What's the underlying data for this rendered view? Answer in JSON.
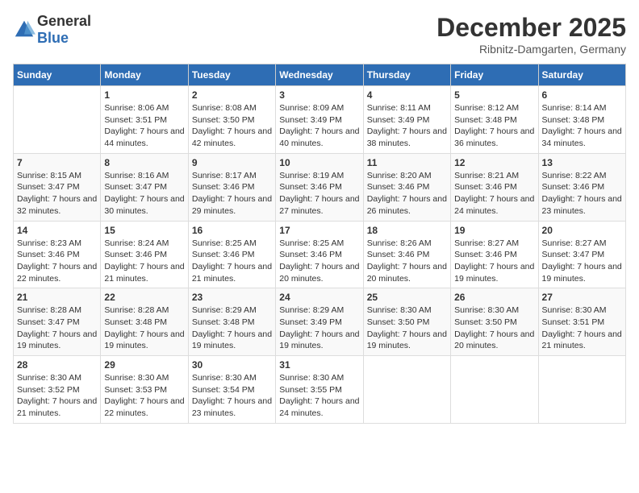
{
  "header": {
    "logo_general": "General",
    "logo_blue": "Blue",
    "month_title": "December 2025",
    "location": "Ribnitz-Damgarten, Germany"
  },
  "days_of_week": [
    "Sunday",
    "Monday",
    "Tuesday",
    "Wednesday",
    "Thursday",
    "Friday",
    "Saturday"
  ],
  "weeks": [
    [
      {
        "day": "",
        "sunrise": "",
        "sunset": "",
        "daylight": ""
      },
      {
        "day": "1",
        "sunrise": "Sunrise: 8:06 AM",
        "sunset": "Sunset: 3:51 PM",
        "daylight": "Daylight: 7 hours and 44 minutes."
      },
      {
        "day": "2",
        "sunrise": "Sunrise: 8:08 AM",
        "sunset": "Sunset: 3:50 PM",
        "daylight": "Daylight: 7 hours and 42 minutes."
      },
      {
        "day": "3",
        "sunrise": "Sunrise: 8:09 AM",
        "sunset": "Sunset: 3:49 PM",
        "daylight": "Daylight: 7 hours and 40 minutes."
      },
      {
        "day": "4",
        "sunrise": "Sunrise: 8:11 AM",
        "sunset": "Sunset: 3:49 PM",
        "daylight": "Daylight: 7 hours and 38 minutes."
      },
      {
        "day": "5",
        "sunrise": "Sunrise: 8:12 AM",
        "sunset": "Sunset: 3:48 PM",
        "daylight": "Daylight: 7 hours and 36 minutes."
      },
      {
        "day": "6",
        "sunrise": "Sunrise: 8:14 AM",
        "sunset": "Sunset: 3:48 PM",
        "daylight": "Daylight: 7 hours and 34 minutes."
      }
    ],
    [
      {
        "day": "7",
        "sunrise": "Sunrise: 8:15 AM",
        "sunset": "Sunset: 3:47 PM",
        "daylight": "Daylight: 7 hours and 32 minutes."
      },
      {
        "day": "8",
        "sunrise": "Sunrise: 8:16 AM",
        "sunset": "Sunset: 3:47 PM",
        "daylight": "Daylight: 7 hours and 30 minutes."
      },
      {
        "day": "9",
        "sunrise": "Sunrise: 8:17 AM",
        "sunset": "Sunset: 3:46 PM",
        "daylight": "Daylight: 7 hours and 29 minutes."
      },
      {
        "day": "10",
        "sunrise": "Sunrise: 8:19 AM",
        "sunset": "Sunset: 3:46 PM",
        "daylight": "Daylight: 7 hours and 27 minutes."
      },
      {
        "day": "11",
        "sunrise": "Sunrise: 8:20 AM",
        "sunset": "Sunset: 3:46 PM",
        "daylight": "Daylight: 7 hours and 26 minutes."
      },
      {
        "day": "12",
        "sunrise": "Sunrise: 8:21 AM",
        "sunset": "Sunset: 3:46 PM",
        "daylight": "Daylight: 7 hours and 24 minutes."
      },
      {
        "day": "13",
        "sunrise": "Sunrise: 8:22 AM",
        "sunset": "Sunset: 3:46 PM",
        "daylight": "Daylight: 7 hours and 23 minutes."
      }
    ],
    [
      {
        "day": "14",
        "sunrise": "Sunrise: 8:23 AM",
        "sunset": "Sunset: 3:46 PM",
        "daylight": "Daylight: 7 hours and 22 minutes."
      },
      {
        "day": "15",
        "sunrise": "Sunrise: 8:24 AM",
        "sunset": "Sunset: 3:46 PM",
        "daylight": "Daylight: 7 hours and 21 minutes."
      },
      {
        "day": "16",
        "sunrise": "Sunrise: 8:25 AM",
        "sunset": "Sunset: 3:46 PM",
        "daylight": "Daylight: 7 hours and 21 minutes."
      },
      {
        "day": "17",
        "sunrise": "Sunrise: 8:25 AM",
        "sunset": "Sunset: 3:46 PM",
        "daylight": "Daylight: 7 hours and 20 minutes."
      },
      {
        "day": "18",
        "sunrise": "Sunrise: 8:26 AM",
        "sunset": "Sunset: 3:46 PM",
        "daylight": "Daylight: 7 hours and 20 minutes."
      },
      {
        "day": "19",
        "sunrise": "Sunrise: 8:27 AM",
        "sunset": "Sunset: 3:46 PM",
        "daylight": "Daylight: 7 hours and 19 minutes."
      },
      {
        "day": "20",
        "sunrise": "Sunrise: 8:27 AM",
        "sunset": "Sunset: 3:47 PM",
        "daylight": "Daylight: 7 hours and 19 minutes."
      }
    ],
    [
      {
        "day": "21",
        "sunrise": "Sunrise: 8:28 AM",
        "sunset": "Sunset: 3:47 PM",
        "daylight": "Daylight: 7 hours and 19 minutes."
      },
      {
        "day": "22",
        "sunrise": "Sunrise: 8:28 AM",
        "sunset": "Sunset: 3:48 PM",
        "daylight": "Daylight: 7 hours and 19 minutes."
      },
      {
        "day": "23",
        "sunrise": "Sunrise: 8:29 AM",
        "sunset": "Sunset: 3:48 PM",
        "daylight": "Daylight: 7 hours and 19 minutes."
      },
      {
        "day": "24",
        "sunrise": "Sunrise: 8:29 AM",
        "sunset": "Sunset: 3:49 PM",
        "daylight": "Daylight: 7 hours and 19 minutes."
      },
      {
        "day": "25",
        "sunrise": "Sunrise: 8:30 AM",
        "sunset": "Sunset: 3:50 PM",
        "daylight": "Daylight: 7 hours and 19 minutes."
      },
      {
        "day": "26",
        "sunrise": "Sunrise: 8:30 AM",
        "sunset": "Sunset: 3:50 PM",
        "daylight": "Daylight: 7 hours and 20 minutes."
      },
      {
        "day": "27",
        "sunrise": "Sunrise: 8:30 AM",
        "sunset": "Sunset: 3:51 PM",
        "daylight": "Daylight: 7 hours and 21 minutes."
      }
    ],
    [
      {
        "day": "28",
        "sunrise": "Sunrise: 8:30 AM",
        "sunset": "Sunset: 3:52 PM",
        "daylight": "Daylight: 7 hours and 21 minutes."
      },
      {
        "day": "29",
        "sunrise": "Sunrise: 8:30 AM",
        "sunset": "Sunset: 3:53 PM",
        "daylight": "Daylight: 7 hours and 22 minutes."
      },
      {
        "day": "30",
        "sunrise": "Sunrise: 8:30 AM",
        "sunset": "Sunset: 3:54 PM",
        "daylight": "Daylight: 7 hours and 23 minutes."
      },
      {
        "day": "31",
        "sunrise": "Sunrise: 8:30 AM",
        "sunset": "Sunset: 3:55 PM",
        "daylight": "Daylight: 7 hours and 24 minutes."
      },
      {
        "day": "",
        "sunrise": "",
        "sunset": "",
        "daylight": ""
      },
      {
        "day": "",
        "sunrise": "",
        "sunset": "",
        "daylight": ""
      },
      {
        "day": "",
        "sunrise": "",
        "sunset": "",
        "daylight": ""
      }
    ]
  ]
}
